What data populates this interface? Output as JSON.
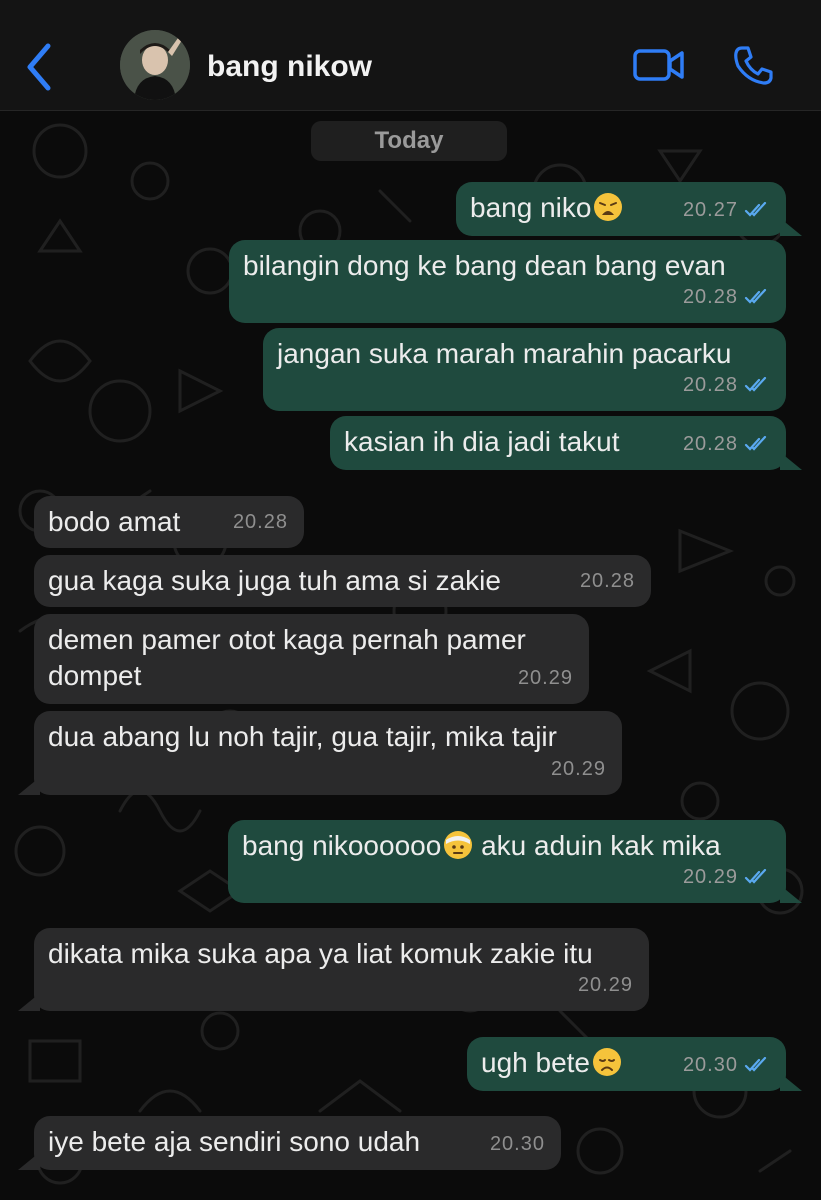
{
  "header": {
    "contact_name": "bang nikow"
  },
  "date_label": "Today",
  "messages": [
    {
      "dir": "out",
      "text": "bang niko",
      "emoji": "weary-face",
      "time": "20.27"
    },
    {
      "dir": "out",
      "text": "bilangin dong ke bang dean bang evan",
      "time": "20.28"
    },
    {
      "dir": "out",
      "text": "jangan suka marah marahin pacarku",
      "time": "20.28"
    },
    {
      "dir": "out",
      "text": "kasian ih dia jadi takut",
      "time": "20.28"
    },
    {
      "dir": "in",
      "text": "bodo amat",
      "time": "20.28"
    },
    {
      "dir": "in",
      "text": "gua kaga suka juga tuh ama si zakie",
      "time": "20.28"
    },
    {
      "dir": "in",
      "text": "demen pamer otot kaga pernah pamer",
      "text2": "dompet",
      "time": "20.29"
    },
    {
      "dir": "in",
      "text": "dua abang lu noh tajir, gua tajir, mika tajir",
      "time": "20.29"
    },
    {
      "dir": "out",
      "text": "bang nikoooooo",
      "emoji": "face-with-head-bandage",
      "text_after": " aku aduin kak mika",
      "time": "20.29"
    },
    {
      "dir": "in",
      "text": "dikata mika suka apa ya liat komuk zakie itu",
      "time": "20.29"
    },
    {
      "dir": "out",
      "text": "ugh bete",
      "emoji": "disappointed-face",
      "time": "20.30"
    },
    {
      "dir": "in",
      "text": "iye bete aja sendiri sono udah",
      "time": "20.30"
    }
  ],
  "colors": {
    "outgoing_bubble": "#1f4a3e",
    "incoming_bubble": "#2a2a2b",
    "accent_blue": "#2f7df6",
    "read_ticks": "#5aa9f0"
  }
}
